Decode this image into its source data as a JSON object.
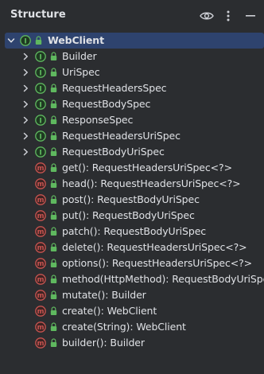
{
  "panel": {
    "title": "Structure",
    "icons": {
      "view_options": "eye-icon",
      "more": "more-vertical-icon",
      "minimize": "minimize-icon"
    }
  },
  "colors": {
    "panel_bg": "#2b2d30",
    "selection": "#2e436e",
    "interface_icon": "#5fb85f",
    "method_icon": "#c75450",
    "lock_icon": "#5fb85f",
    "text": "#dfe1e5"
  },
  "tree": {
    "root": {
      "label": "WebClient",
      "kind": "interface",
      "expanded": true,
      "selected": true
    },
    "interfaces": [
      {
        "label": "Builder",
        "kind": "interface"
      },
      {
        "label": "UriSpec",
        "kind": "interface"
      },
      {
        "label": "RequestHeadersSpec",
        "kind": "interface"
      },
      {
        "label": "RequestBodySpec",
        "kind": "interface"
      },
      {
        "label": "ResponseSpec",
        "kind": "interface"
      },
      {
        "label": "RequestHeadersUriSpec",
        "kind": "interface"
      },
      {
        "label": "RequestBodyUriSpec",
        "kind": "interface"
      }
    ],
    "methods": [
      {
        "label": "get(): RequestHeadersUriSpec<?>",
        "kind": "method"
      },
      {
        "label": "head(): RequestHeadersUriSpec<?>",
        "kind": "method"
      },
      {
        "label": "post(): RequestBodyUriSpec",
        "kind": "method"
      },
      {
        "label": "put(): RequestBodyUriSpec",
        "kind": "method"
      },
      {
        "label": "patch(): RequestBodyUriSpec",
        "kind": "method"
      },
      {
        "label": "delete(): RequestHeadersUriSpec<?>",
        "kind": "method"
      },
      {
        "label": "options(): RequestHeadersUriSpec<?>",
        "kind": "method"
      },
      {
        "label": "method(HttpMethod): RequestBodyUriSpec",
        "kind": "method"
      },
      {
        "label": "mutate(): Builder",
        "kind": "method"
      },
      {
        "label": "create(): WebClient",
        "kind": "method"
      },
      {
        "label": "create(String): WebClient",
        "kind": "method"
      },
      {
        "label": "builder(): Builder",
        "kind": "method"
      }
    ]
  }
}
